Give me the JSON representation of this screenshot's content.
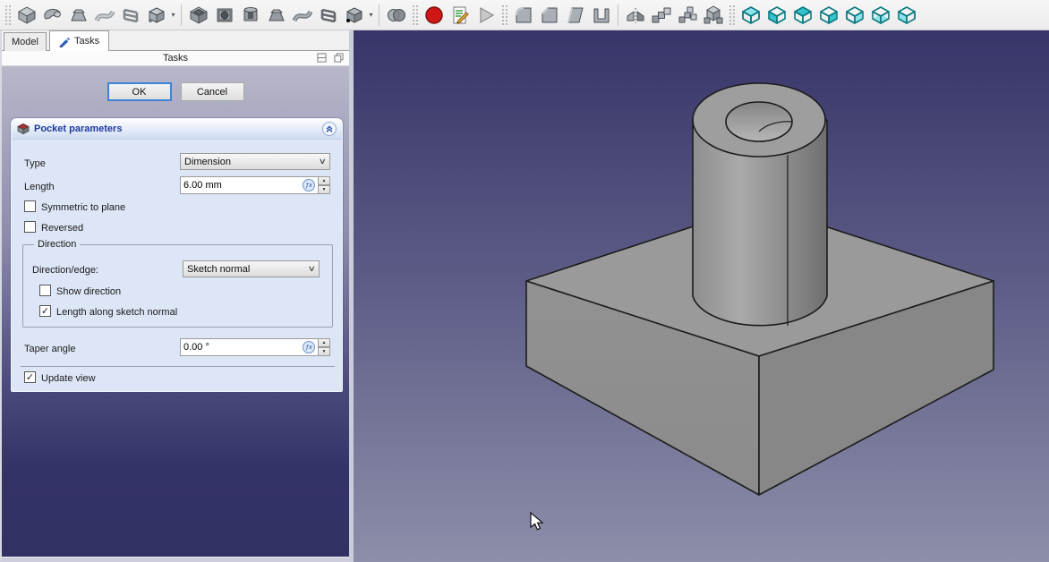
{
  "tabs": {
    "model": "Model",
    "tasks": "Tasks"
  },
  "panel": {
    "title": "Tasks",
    "ok": "OK",
    "cancel": "Cancel"
  },
  "pocket": {
    "title": "Pocket parameters",
    "type_label": "Type",
    "type_value": "Dimension",
    "length_label": "Length",
    "length_value": "6.00 mm",
    "symmetric_label": "Symmetric to plane",
    "reversed_label": "Reversed",
    "direction_group_label": "Direction",
    "direction_edge_label": "Direction/edge:",
    "direction_edge_value": "Sketch normal",
    "show_direction_label": "Show direction",
    "length_along_label": "Length along sketch normal",
    "taper_label": "Taper angle",
    "taper_value": "0.00 °",
    "update_view_label": "Update view",
    "checks": {
      "symmetric": "",
      "reversed": "",
      "show_direction": "",
      "length_along": "✓",
      "update_view": "✓"
    }
  },
  "toolbar": {
    "groups": [
      {
        "name": "part-design-modeling",
        "icons": [
          "pad",
          "revolution",
          "additive-loft",
          "additive-sweep",
          "additive-helix",
          "additive-primitives",
          "pocket",
          "hole",
          "groove",
          "subtractive-loft",
          "subtractive-sweep",
          "subtractive-helix",
          "subtractive-primitives",
          "boolean"
        ]
      },
      {
        "name": "macro",
        "icons": [
          "macro-record",
          "macro-edit",
          "macro-execute"
        ]
      },
      {
        "name": "dress-up",
        "icons": [
          "fillet",
          "chamfer",
          "draft",
          "thickness"
        ]
      },
      {
        "name": "transform",
        "icons": [
          "mirrored",
          "linear-pattern",
          "polar-pattern",
          "multitransform"
        ]
      },
      {
        "name": "standard-views",
        "icons": [
          "axonometric",
          "front",
          "top",
          "right",
          "rear",
          "bottom",
          "left"
        ]
      }
    ]
  },
  "colors": {
    "accent_blue": "#1d3c9c",
    "record_red": "#cf1717",
    "view_teal": "#35c4cc",
    "panel_gradient_top": "#b8b8ca",
    "panel_gradient_bottom": "#323164",
    "viewport_gradient_top": "#373569",
    "viewport_gradient_bottom": "#8d8ea9",
    "part_gray": "#949494"
  }
}
